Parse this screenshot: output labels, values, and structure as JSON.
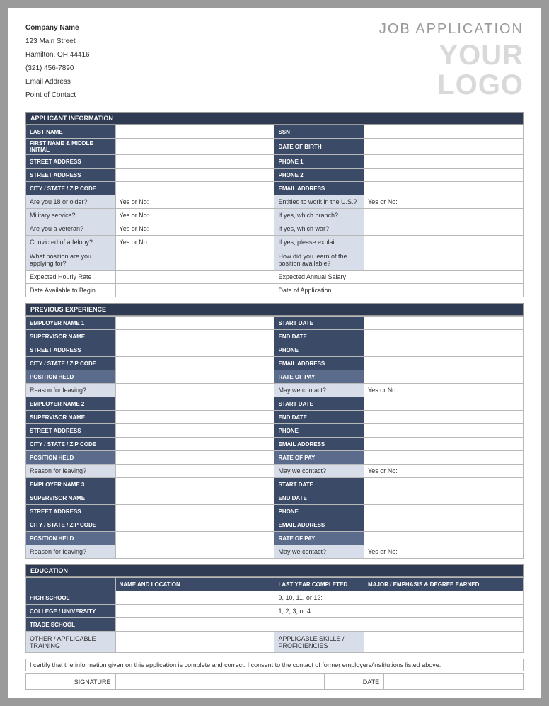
{
  "company": {
    "name": "Company Name",
    "street": "123 Main Street",
    "citystatezip": "Hamilton, OH 44416",
    "phone": "(321) 456-7890",
    "email": "Email Address",
    "contact": "Point of Contact"
  },
  "header": {
    "title": "JOB APPLICATION",
    "logo1": "YOUR",
    "logo2": "LOGO"
  },
  "sections": {
    "applicant": "APPLICANT INFORMATION",
    "previous": "PREVIOUS EXPERIENCE",
    "education": "EDUCATION"
  },
  "applicant": {
    "last_name": "LAST NAME",
    "ssn": "SSN",
    "first_mi": "FIRST NAME & MIDDLE INITIAL",
    "dob": "DATE OF BIRTH",
    "addr1": "STREET ADDRESS",
    "phone1": "PHONE 1",
    "addr2": "STREET ADDRESS",
    "phone2": "PHONE 2",
    "csz": "CITY / STATE / ZIP CODE",
    "email": "EMAIL ADDRESS",
    "q_age": "Are you 18 or older?",
    "q_us": "Entitled to work in the U.S.?",
    "q_mil": "Military service?",
    "q_branch": "If yes, which branch?",
    "q_vet": "Are you a veteran?",
    "q_war": "If yes, which war?",
    "q_felony": "Convicted of a felony?",
    "q_explain": "If yes, please explain.",
    "q_position": "What position are you applying for?",
    "q_learn": "How did you learn of the position available?",
    "q_hourly": "Expected Hourly Rate",
    "q_salary": "Expected Annual Salary",
    "q_start": "Date Available to Begin",
    "q_appdate": "Date of Application",
    "yesno": "Yes or No:"
  },
  "experience": {
    "emp1": "EMPLOYER NAME 1",
    "emp2": "EMPLOYER NAME 2",
    "emp3": "EMPLOYER NAME 3",
    "supervisor": "SUPERVISOR NAME",
    "addr": "STREET ADDRESS",
    "csz": "CITY / STATE / ZIP CODE",
    "position": "POSITION HELD",
    "start": "START DATE",
    "end": "END DATE",
    "phone": "PHONE",
    "email": "EMAIL ADDRESS",
    "rate": "RATE OF PAY",
    "reason": "Reason for leaving?",
    "contact": "May we contact?",
    "yesno": "Yes or No:"
  },
  "education": {
    "col_name": "NAME AND LOCATION",
    "col_year": "LAST YEAR COMPLETED",
    "col_major": "MAJOR / EMPHASIS & DEGREE EARNED",
    "highschool": "HIGH SCHOOL",
    "hs_years": "9, 10, 11, or 12:",
    "college": "COLLEGE / UNIVERSITY",
    "college_years": "1, 2, 3, or 4:",
    "trade": "TRADE SCHOOL",
    "other": "OTHER / APPLICABLE TRAINING",
    "skills": "APPLICABLE SKILLS / PROFICIENCIES"
  },
  "cert": "I certify that the information given on this application is complete and correct. I consent to the contact of former employers/institutions listed above.",
  "sig": {
    "signature": "SIGNATURE",
    "date": "DATE"
  }
}
